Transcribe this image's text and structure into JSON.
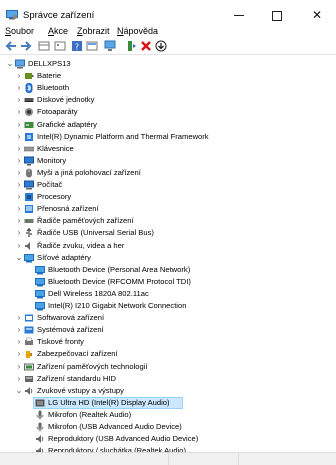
{
  "window": {
    "title": "Správce zařízení",
    "minimize_glyph": "",
    "maximize_glyph": "",
    "close_glyph": "✕"
  },
  "menu": {
    "items": [
      "Soubor",
      "Akce",
      "Zobrazit",
      "Nápověda"
    ]
  },
  "toolbar": {
    "icons": [
      "back-arrow-icon",
      "forward-arrow-icon",
      "properties-grid-icon",
      "list-view-icon",
      "help-icon",
      "resources-icon",
      "monitor-scan-icon",
      "add-driver-icon",
      "remove-device-icon",
      "download-update-icon"
    ]
  },
  "tree": {
    "root": "DELLXPS13",
    "nodes": [
      {
        "label": "Baterie",
        "icon": "battery-icon",
        "expanded": false
      },
      {
        "label": "Bluetooth",
        "icon": "bluetooth-icon",
        "expanded": false
      },
      {
        "label": "Diskové jednotky",
        "icon": "disk-drive-icon",
        "expanded": false
      },
      {
        "label": "Fotoaparáty",
        "icon": "camera-icon",
        "expanded": false
      },
      {
        "label": "Grafické adaptéry",
        "icon": "display-adapter-icon",
        "expanded": false
      },
      {
        "label": "Intel(R) Dynamic Platform and Thermal Framework",
        "icon": "chip-icon",
        "expanded": false
      },
      {
        "label": "Klávesnice",
        "icon": "keyboard-icon",
        "expanded": false
      },
      {
        "label": "Monitory",
        "icon": "monitor-icon",
        "expanded": false
      },
      {
        "label": "Myši a jiná polohovací zařízení",
        "icon": "mouse-icon",
        "expanded": false
      },
      {
        "label": "Počítač",
        "icon": "computer-icon",
        "expanded": false
      },
      {
        "label": "Procesory",
        "icon": "processor-icon",
        "expanded": false
      },
      {
        "label": "Přenosná zařízení",
        "icon": "portable-device-icon",
        "expanded": false
      },
      {
        "label": "Řadiče paměťových zařízení",
        "icon": "storage-controller-icon",
        "expanded": false
      },
      {
        "label": "Řadiče USB (Universal Serial Bus)",
        "icon": "usb-icon",
        "expanded": false
      },
      {
        "label": "Řadiče zvuku, videa a her",
        "icon": "speaker-icon",
        "expanded": false
      },
      {
        "label": "Síťové adaptéry",
        "icon": "network-adapter-icon",
        "expanded": true,
        "children": [
          {
            "label": "Bluetooth Device (Personal Area Network)",
            "icon": "network-adapter-icon"
          },
          {
            "label": "Bluetooth Device (RFCOMM Protocol TDI)",
            "icon": "network-adapter-icon"
          },
          {
            "label": "Dell Wireless 1820A 802.11ac",
            "icon": "network-adapter-icon"
          },
          {
            "label": "Intel(R) I210 Gigabit Network Connection",
            "icon": "network-adapter-icon"
          }
        ]
      },
      {
        "label": "Softwarová zařízení",
        "icon": "software-device-icon",
        "expanded": false
      },
      {
        "label": "Systémová zařízení",
        "icon": "system-device-icon",
        "expanded": false
      },
      {
        "label": "Tiskové fronty",
        "icon": "printer-icon",
        "expanded": false
      },
      {
        "label": "Zabezpečovací zařízení",
        "icon": "security-key-icon",
        "expanded": false
      },
      {
        "label": "Zařízení paměťových technologií",
        "icon": "memory-tech-icon",
        "expanded": false
      },
      {
        "label": "Zařízení standardu HID",
        "icon": "hid-icon",
        "expanded": false
      },
      {
        "label": "Zvukové vstupy a výstupy",
        "icon": "audio-io-icon",
        "expanded": true,
        "children": [
          {
            "label": "LG Ultra HD (Intel(R) Display Audio)",
            "icon": "audio-output-icon",
            "selected": true
          },
          {
            "label": "Mikrofon (Realtek Audio)",
            "icon": "microphone-icon"
          },
          {
            "label": "Mikrofon (USB Advanced Audio Device)",
            "icon": "microphone-icon"
          },
          {
            "label": "Reproduktory (USB Advanced Audio Device)",
            "icon": "speaker-output-icon"
          },
          {
            "label": "Reproduktory / sluchátka (Realtek Audio)",
            "icon": "speaker-output-icon"
          }
        ]
      }
    ]
  },
  "colors": {
    "selection": "#cce8ff",
    "selection_border": "#99d1ff",
    "folder_blue": "#2b7bd6"
  }
}
